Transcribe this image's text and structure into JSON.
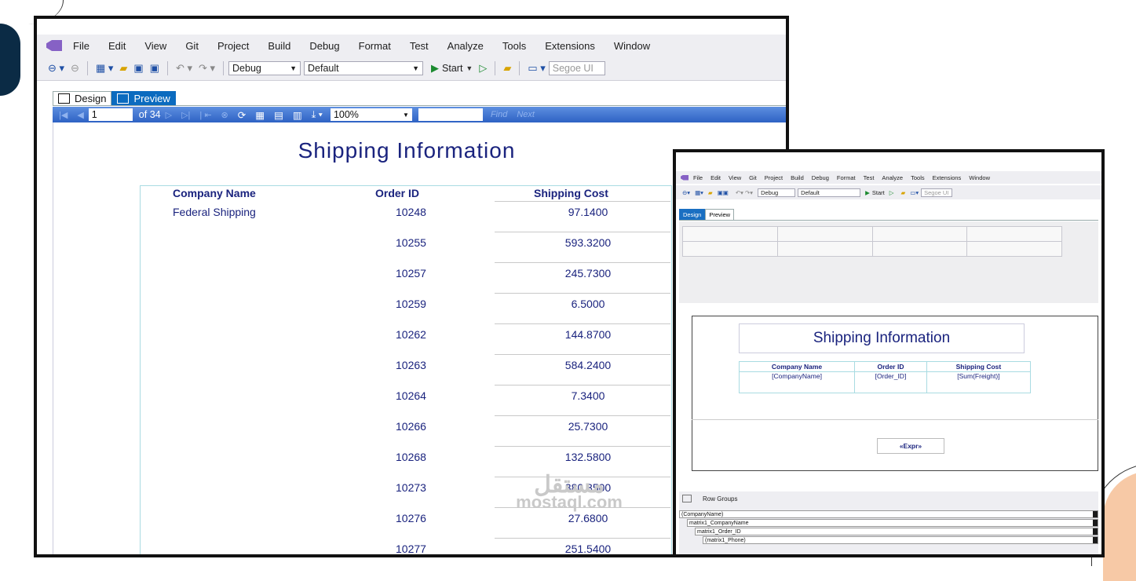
{
  "main": {
    "menu": [
      "File",
      "Edit",
      "View",
      "Git",
      "Project",
      "Build",
      "Debug",
      "Format",
      "Test",
      "Analyze",
      "Tools",
      "Extensions",
      "Window"
    ],
    "toolbar": {
      "config": "Debug",
      "platform": "Default",
      "start": "Start",
      "font": "Segoe UI"
    },
    "tabs": {
      "design": "Design",
      "preview": "Preview"
    },
    "nav": {
      "page": "1",
      "of_pages": "of 34",
      "zoom": "100%",
      "find": "Find",
      "next": "Next"
    },
    "report_title": "Shipping Information",
    "headers": {
      "company": "Company Name",
      "order": "Order ID",
      "cost": "Shipping Cost"
    },
    "company": "Federal Shipping",
    "rows": [
      {
        "order": "10248",
        "cost": "97.1400"
      },
      {
        "order": "10255",
        "cost": "593.3200"
      },
      {
        "order": "10257",
        "cost": "245.7300"
      },
      {
        "order": "10259",
        "cost": "6.5000"
      },
      {
        "order": "10262",
        "cost": "144.8700"
      },
      {
        "order": "10263",
        "cost": "584.2400"
      },
      {
        "order": "10264",
        "cost": "7.3400"
      },
      {
        "order": "10266",
        "cost": "25.7300"
      },
      {
        "order": "10268",
        "cost": "132.5800"
      },
      {
        "order": "10273",
        "cost": "380.3500"
      },
      {
        "order": "10276",
        "cost": "27.6800"
      },
      {
        "order": "10277",
        "cost": "251.5400"
      }
    ]
  },
  "design": {
    "menu": [
      "File",
      "Edit",
      "View",
      "Git",
      "Project",
      "Build",
      "Debug",
      "Format",
      "Test",
      "Analyze",
      "Tools",
      "Extensions",
      "Window"
    ],
    "toolbar": {
      "config": "Debug",
      "platform": "Default",
      "start": "Start",
      "font": "Segoe UI"
    },
    "tabs": {
      "design": "Design",
      "preview": "Preview"
    },
    "title": "Shipping Information",
    "headers": {
      "company": "Company Name",
      "order": "Order ID",
      "cost": "Shipping Cost"
    },
    "fields": {
      "company": "[CompanyName]",
      "order": "[Order_ID]",
      "cost": "[Sum(Freight)]"
    },
    "expr": "«Expr»",
    "row_groups_label": "Row Groups",
    "row_groups": [
      "(CompanyName)",
      "matrix1_CompanyName",
      "matrix1_Order_ID",
      "(matrix1_Phone)"
    ]
  },
  "watermark": {
    "arabic": "مستقل",
    "latin": "mostaql.com"
  },
  "colors": {
    "title": "#1a237e",
    "nav_bar": "#3a6fd0",
    "table_border": "#a9dbe2",
    "deco_navy": "#0b2b45",
    "deco_peach": "#f7c9a6"
  }
}
